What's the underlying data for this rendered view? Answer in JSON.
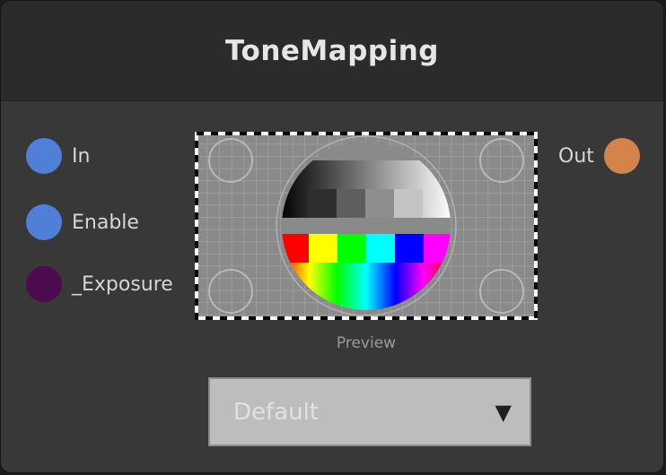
{
  "node": {
    "title": "ToneMapping"
  },
  "inputs": [
    {
      "label": "In",
      "color": "#4f7fd6"
    },
    {
      "label": "Enable",
      "color": "#4f7fd6"
    },
    {
      "label": "_Exposure",
      "color": "#4d0a4e"
    }
  ],
  "outputs": [
    {
      "label": "Out",
      "color": "#d4834b"
    }
  ],
  "preview": {
    "caption": "Preview"
  },
  "dropdown": {
    "value": "Default",
    "arrow_icon": "caret-down-icon"
  }
}
